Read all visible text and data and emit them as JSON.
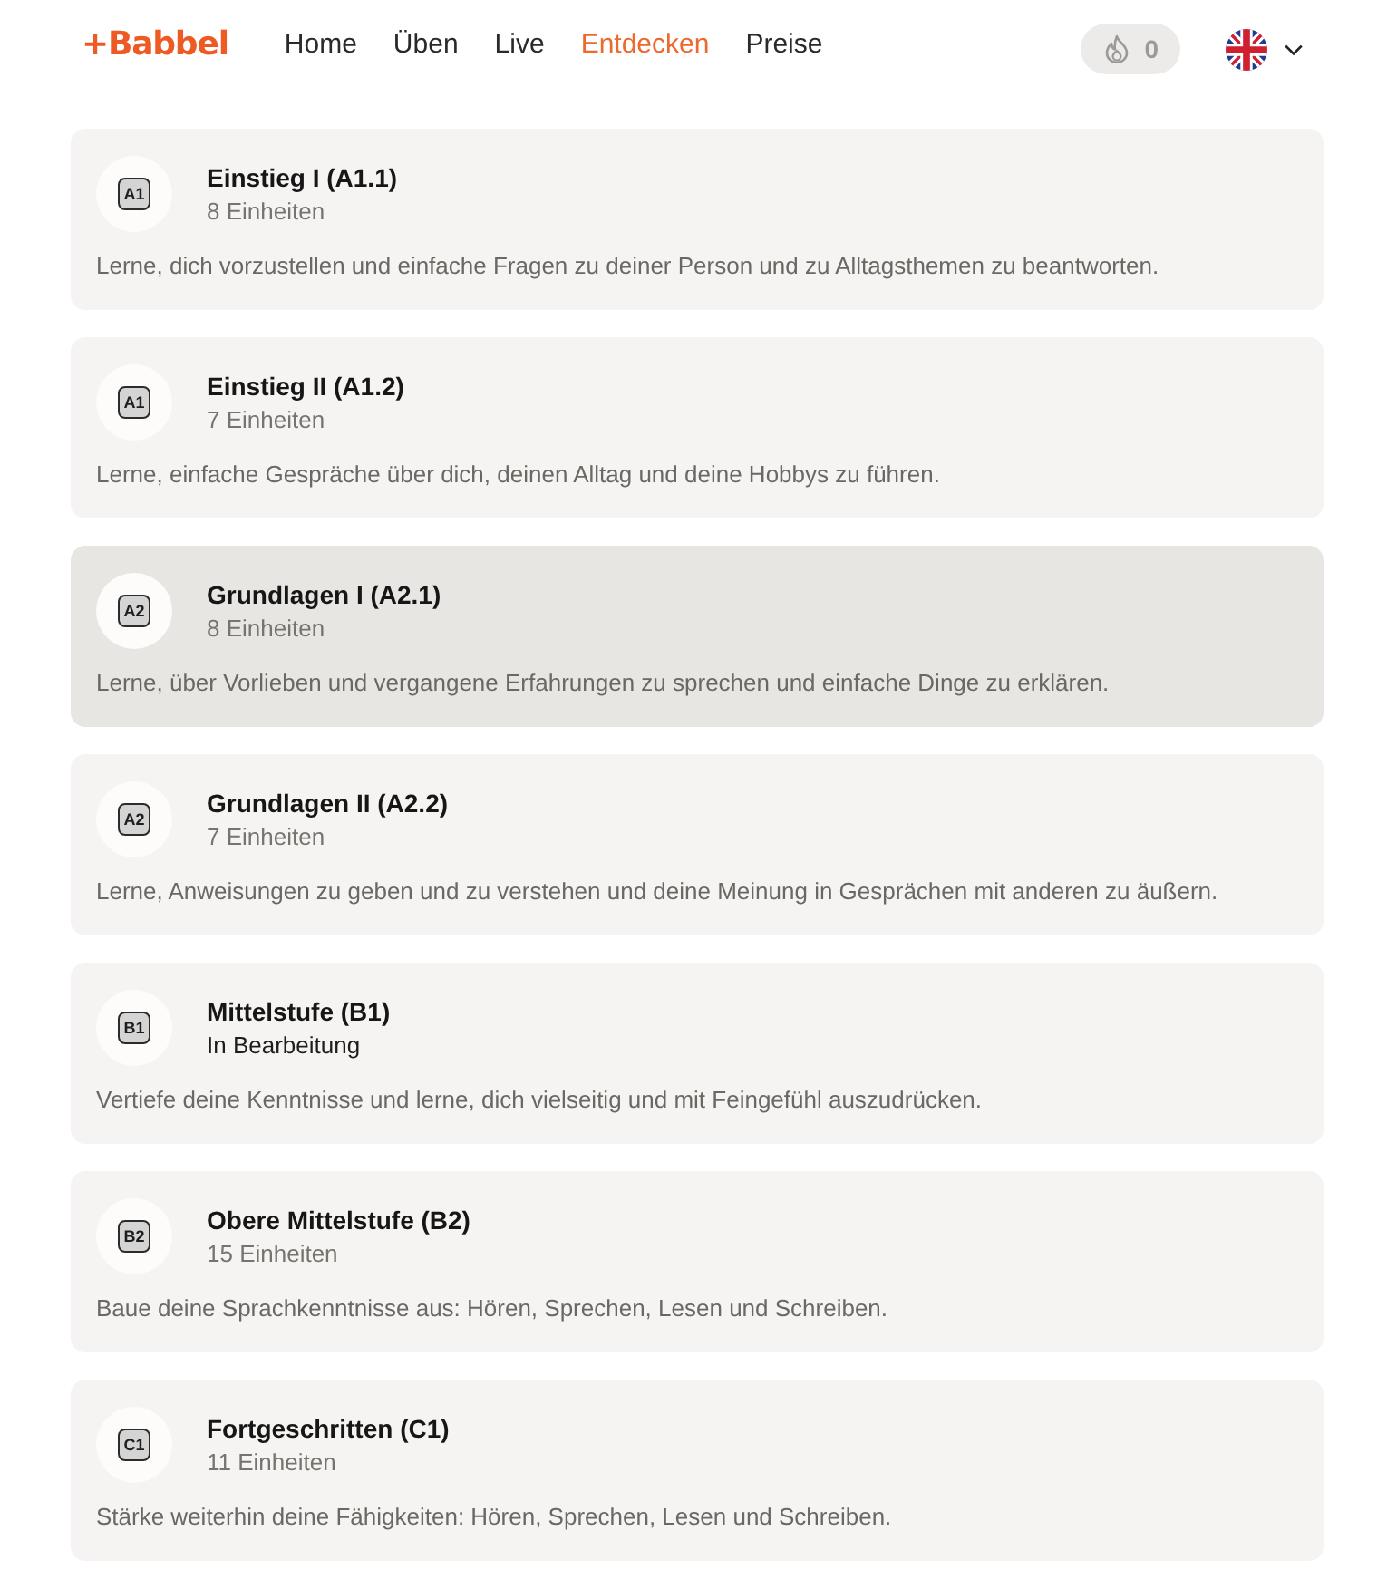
{
  "header": {
    "logo": "+Babbel",
    "nav": [
      {
        "label": "Home",
        "selected": false
      },
      {
        "label": "Üben",
        "selected": false
      },
      {
        "label": "Live",
        "selected": false
      },
      {
        "label": "Entdecken",
        "selected": true
      },
      {
        "label": "Preise",
        "selected": false
      }
    ],
    "streak": {
      "count": "0"
    }
  },
  "courses": [
    {
      "badge": "A1",
      "title": "Einstieg I (A1.1)",
      "subtitle": "8 Einheiten",
      "in_progress": false,
      "highlighted": false,
      "description": "Lerne, dich vorzustellen und einfache Fragen zu deiner Person und zu Alltagsthemen zu beantworten."
    },
    {
      "badge": "A1",
      "title": "Einstieg II (A1.2)",
      "subtitle": "7 Einheiten",
      "in_progress": false,
      "highlighted": false,
      "description": "Lerne, einfache Gespräche über dich, deinen Alltag und deine Hobbys zu führen."
    },
    {
      "badge": "A2",
      "title": "Grundlagen I (A2.1)",
      "subtitle": "8 Einheiten",
      "in_progress": false,
      "highlighted": true,
      "description": "Lerne, über Vorlieben und vergangene Erfahrungen zu sprechen und einfache Dinge zu erklären."
    },
    {
      "badge": "A2",
      "title": "Grundlagen II (A2.2)",
      "subtitle": "7 Einheiten",
      "in_progress": false,
      "highlighted": false,
      "description": "Lerne, Anweisungen zu geben und zu verstehen und deine Meinung in Gesprächen mit anderen zu äußern."
    },
    {
      "badge": "B1",
      "title": "Mittelstufe (B1)",
      "subtitle": "In Bearbeitung",
      "in_progress": true,
      "highlighted": false,
      "description": "Vertiefe deine Kenntnisse und lerne, dich vielseitig und mit Feingefühl auszudrücken."
    },
    {
      "badge": "B2",
      "title": "Obere Mittelstufe (B2)",
      "subtitle": "15 Einheiten",
      "in_progress": false,
      "highlighted": false,
      "description": "Baue deine Sprachkenntnisse aus: Hören, Sprechen, Lesen und Schreiben."
    },
    {
      "badge": "C1",
      "title": "Fortgeschritten (C1)",
      "subtitle": "11 Einheiten",
      "in_progress": false,
      "highlighted": false,
      "description": "Stärke weiterhin deine Fähigkeiten: Hören, Sprechen, Lesen und Schreiben."
    }
  ]
}
